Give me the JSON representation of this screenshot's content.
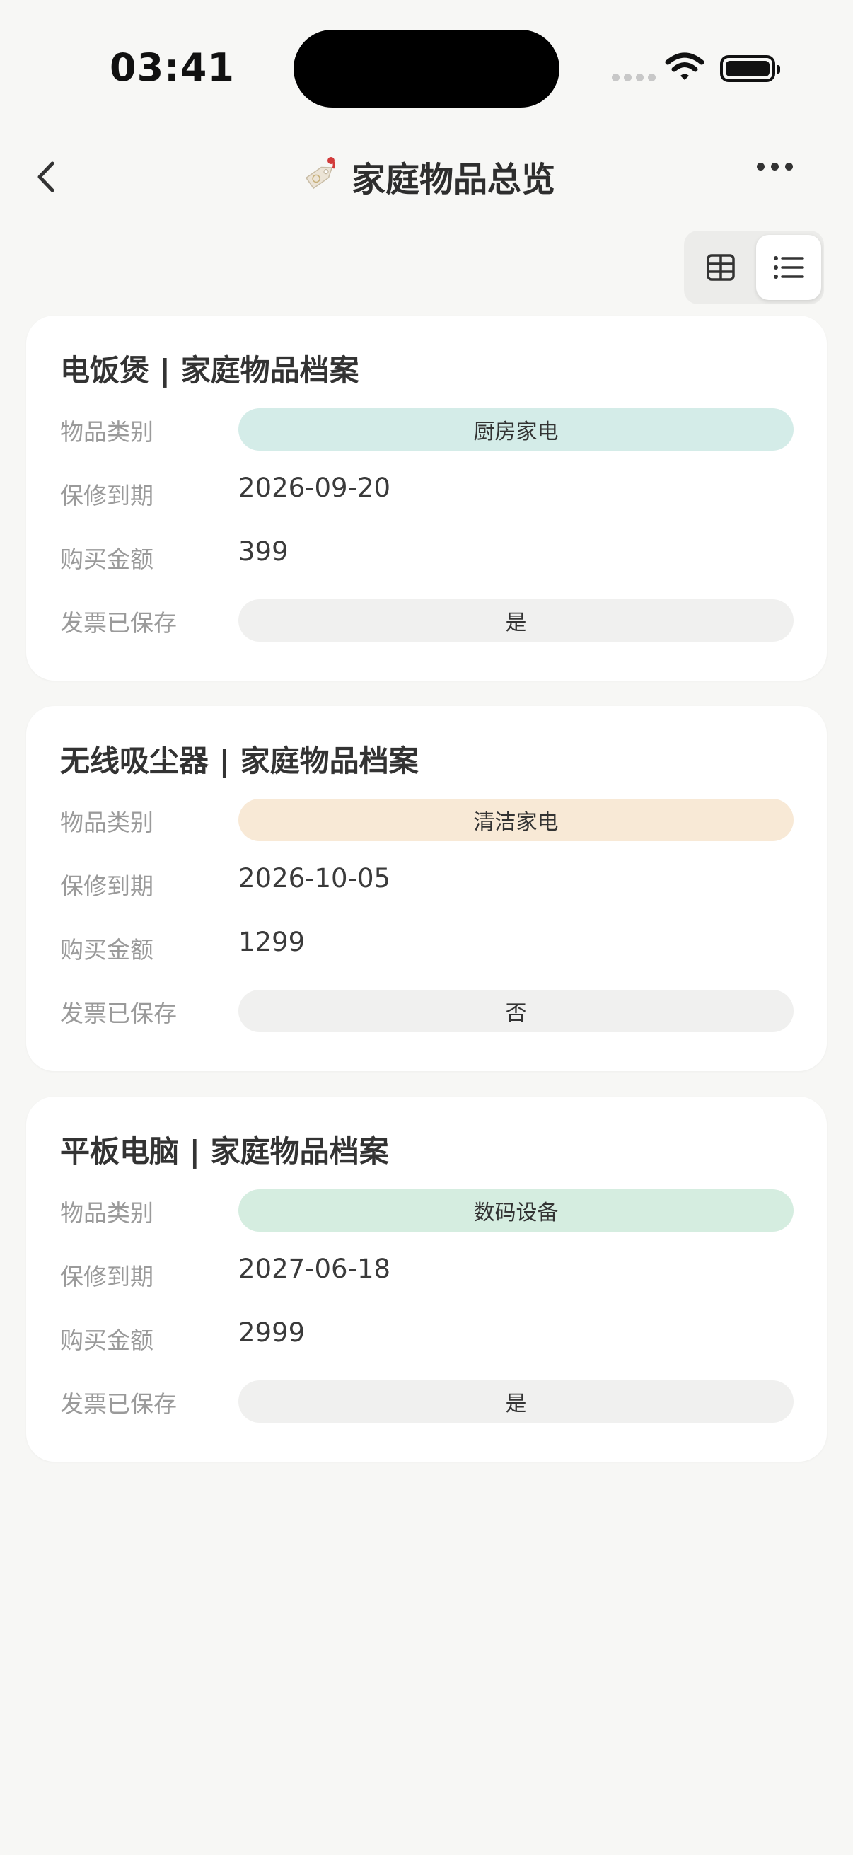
{
  "status": {
    "time": "03:41"
  },
  "nav": {
    "title": "家庭物品总览"
  },
  "labels": {
    "category": "物品类别",
    "warranty": "保修到期",
    "amount": "购买金额",
    "invoice": "发票已保存"
  },
  "items": [
    {
      "title": "电饭煲 | 家庭物品档案",
      "category": "厨房家电",
      "category_color": "#d4ece8",
      "warranty": "2026-09-20",
      "amount": "399",
      "invoice": "是"
    },
    {
      "title": "无线吸尘器 | 家庭物品档案",
      "category": "清洁家电",
      "category_color": "#f8e9d6",
      "warranty": "2026-10-05",
      "amount": "1299",
      "invoice": "否"
    },
    {
      "title": "平板电脑 | 家庭物品档案",
      "category": "数码设备",
      "category_color": "#d5ede0",
      "warranty": "2027-06-18",
      "amount": "2999",
      "invoice": "是"
    }
  ]
}
